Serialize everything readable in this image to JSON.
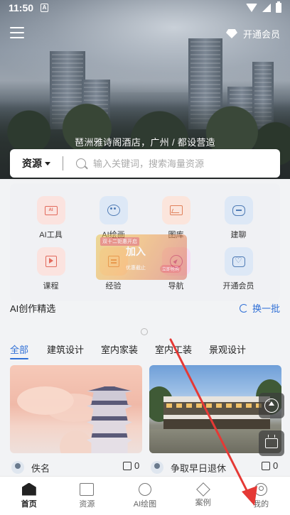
{
  "status_bar": {
    "time": "11:50",
    "notif_letter": "A"
  },
  "header": {
    "member_label": "开通会员"
  },
  "hero": {
    "caption": "琶洲雅诗阁酒店，广州 / 都设营造"
  },
  "search": {
    "category": "资源",
    "placeholder": "输入关键词，搜索海量资源"
  },
  "grid": [
    {
      "label": "AI工具",
      "icon": "ai-tool-icon"
    },
    {
      "label": "AI绘画",
      "icon": "palette-icon"
    },
    {
      "label": "图库",
      "icon": "gallery-icon"
    },
    {
      "label": "建聊",
      "icon": "chat-icon"
    },
    {
      "label": "课程",
      "icon": "video-icon"
    },
    {
      "label": "经验",
      "icon": "book-icon"
    },
    {
      "label": "导航",
      "icon": "compass-icon"
    },
    {
      "label": "开通会员",
      "icon": "member-icon"
    }
  ],
  "promo": {
    "tag": "双十二钜惠开启",
    "main": "加入",
    "sub": "优惠截止",
    "right": "立即抢购"
  },
  "ai_section": {
    "title": "AI创作精选",
    "refresh_label": "换一批",
    "tabs": [
      "全部",
      "建筑设计",
      "室内家装",
      "室内工装",
      "景观设计"
    ],
    "active_tab": 0,
    "cards": [
      {
        "author": "佚名",
        "likes": "0"
      },
      {
        "author": "争取早日退休",
        "likes": "0"
      }
    ]
  },
  "tabbar": [
    {
      "label": "首页",
      "icon": "home-icon",
      "active": true
    },
    {
      "label": "资源",
      "icon": "folder-icon",
      "active": false
    },
    {
      "label": "AI绘图",
      "icon": "paint-icon",
      "active": false
    },
    {
      "label": "案例",
      "icon": "tools-icon",
      "active": false
    },
    {
      "label": "我的",
      "icon": "user-icon",
      "active": false
    }
  ],
  "colors": {
    "accent": "#2f6fd6",
    "annotation_arrow": "#e53935"
  }
}
